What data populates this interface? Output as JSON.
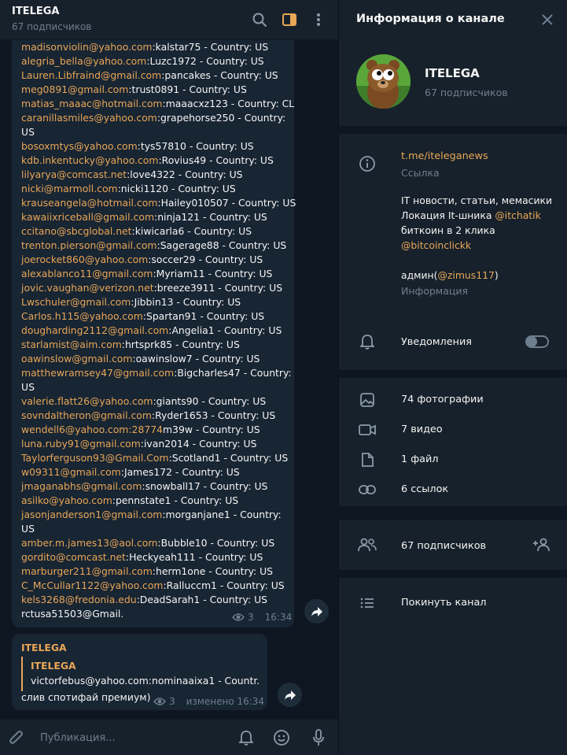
{
  "chat": {
    "title": "ITELEGA",
    "subtitle": "67 подписчиков",
    "lines": [
      {
        "link": "madisonviolin@yahoo.com",
        "rest": ":kalstar75 - Country: US"
      },
      {
        "link": "alegria_bella@yahoo.com",
        "rest": ":Luzc1972 - Country: US"
      },
      {
        "link": "Lauren.Libfraind@gmail.com",
        "rest": ":pancakes - Country: US"
      },
      {
        "link": "meg0891@gmail.com",
        "rest": ":trust0891 - Country: US"
      },
      {
        "link": "matias_maaac@hotmail.com",
        "rest": ":maaacxz123 - Country: CL"
      },
      {
        "link": "caranillasmiles@yahoo.com",
        "rest": ":grapehorse250 - Country:"
      },
      {
        "link": "",
        "rest": "US"
      },
      {
        "link": "bosoxmtys@yahoo.com",
        "rest": ":tys57810 - Country: US"
      },
      {
        "link": "kdb.inkentucky@yahoo.com",
        "rest": ":Rovius49 - Country: US"
      },
      {
        "link": "lilyarya@comcast.net",
        "rest": ":love4322 - Country: US"
      },
      {
        "link": "nicki@marmoll.com",
        "rest": ":nicki1120 - Country: US"
      },
      {
        "link": "krauseangela@hotmail.com",
        "rest": ":Hailey010507 - Country: US"
      },
      {
        "link": "kawaiixriceball@gmail.com",
        "rest": ":ninja121 - Country: US"
      },
      {
        "link": "ccitano@sbcglobal.net",
        "rest": ":kiwicarla6 - Country: US"
      },
      {
        "link": "trenton.pierson@gmail.com",
        "rest": ":Sagerage88 - Country: US"
      },
      {
        "link": "joerocket860@yahoo.com",
        "rest": ":soccer29 - Country: US"
      },
      {
        "link": "alexablanco11@gmail.com",
        "rest": ":Myriam11 - Country: US"
      },
      {
        "link": "jovic.vaughan@verizon.net",
        "rest": ":breeze3911 - Country: US"
      },
      {
        "link": "Lwschuler@gmail.com",
        "rest": ":Jibbin13 - Country: US"
      },
      {
        "link": "Carlos.h115@yahoo.com",
        "rest": ":Spartan91 - Country: US"
      },
      {
        "link": "dougharding2112@gmail.com",
        "rest": ":Angelia1 - Country: US"
      },
      {
        "link": "starlamist@aim.com",
        "rest": ":hrtsprk85 - Country: US"
      },
      {
        "link": "oawinslow@gmail.com",
        "rest": ":oawinslow7 - Country: US"
      },
      {
        "link": "matthewramsey47@gmail.com",
        "rest": ":Bigcharles47 - Country:"
      },
      {
        "link": "",
        "rest": "US"
      },
      {
        "link": "valerie.flatt26@yahoo.com",
        "rest": ":giants90 - Country: US"
      },
      {
        "link": "sovndaltheron@gmail.com",
        "rest": ":Ryder1653 - Country: US"
      },
      {
        "link": "wendell6@yahoo.com:28774",
        "rest": "m39w - Country: US"
      },
      {
        "link": "luna.ruby91@gmail.com",
        "rest": ":ivan2014 - Country: US"
      },
      {
        "link": "Taylorferguson93@Gmail.Com",
        "rest": ":Scotland1 - Country: US"
      },
      {
        "link": "w09311@gmail.com",
        "rest": ":James172 - Country: US"
      },
      {
        "link": "jmaganabhs@gmail.com",
        "rest": ":snowball17 - Country: US"
      },
      {
        "link": "asilko@yahoo.com",
        "rest": ":pennstate1 - Country: US"
      },
      {
        "link": "jasonjanderson1@gmail.com",
        "rest": ":morganjane1 - Country:"
      },
      {
        "link": "",
        "rest": "US"
      },
      {
        "link": "amber.m.james13@aol.com",
        "rest": ":Bubble10 - Country: US"
      },
      {
        "link": "gordito@comcast.net",
        "rest": ":Heckyeah111 - Country: US"
      },
      {
        "link": "marburger211@gmail.com",
        "rest": ":herm1one - Country: US"
      },
      {
        "link": "C_McCullar1122@yahoo.com",
        "rest": ":Ralluccm1 - Country: US"
      },
      {
        "link": "kels3268@fredonia.edu",
        "rest": ":DeadSarah1 - Country: US"
      },
      {
        "link": "",
        "rest": "rctusa51503@Gmail."
      }
    ],
    "msg1_views": "3",
    "msg1_time": "16:34",
    "msg2": {
      "author": "ITELEGA",
      "quote_author": "ITELEGA",
      "quote_text": "victorfebus@yahoo.com:nominaaixa1 - Countr...",
      "text": "слив спотифай премиум)",
      "views": "3",
      "time": "изменено 16:34"
    },
    "composer_placeholder": "Публикация..."
  },
  "panel": {
    "title": "Информация о канале",
    "channel_name": "ITELEGA",
    "channel_sub": "67 подписчиков",
    "link": "t.me/iteleganews",
    "link_label": "Ссылка",
    "desc_line1": "IT новости, статьи, мемасики",
    "desc_line2_pre": "Локация It-шника ",
    "desc_line2_link": "@itchatik",
    "desc_line3": "биткоин в 2 клика",
    "desc_line4_link": "@bitcoinclickk",
    "desc_line5_pre": "админ(",
    "desc_line5_link": "@zimus117",
    "desc_line5_post": ")",
    "info_label": "Информация",
    "notifications": "Уведомления",
    "notifications_on": false,
    "photos": "74 фотографии",
    "videos": "7 видео",
    "files": "1 файл",
    "links": "6 ссылок",
    "subscribers": "67 подписчиков",
    "leave": "Покинуть канал"
  },
  "colors": {
    "accent": "#e8a657",
    "bg": "#0e1621",
    "panel": "#17212b",
    "bubble": "#182533",
    "muted": "#6d7f8f"
  }
}
